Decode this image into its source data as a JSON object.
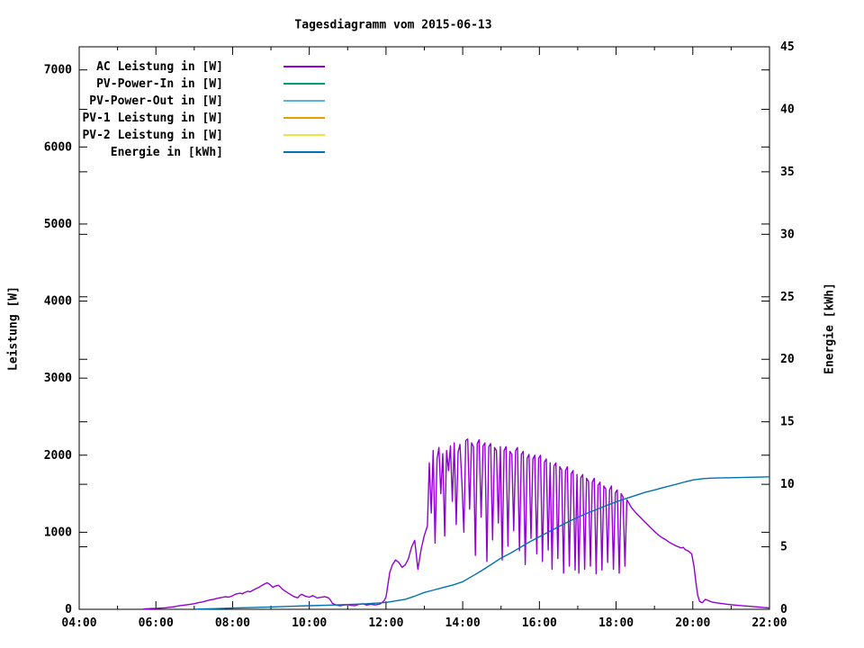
{
  "chart_data": {
    "type": "line",
    "title": "Tagesdiagramm vom 2015-06-13",
    "background": "#ffffff",
    "text_color": "#000000",
    "x_axis": {
      "range_hours": [
        4,
        22
      ],
      "major_ticks": [
        "04:00",
        "06:00",
        "08:00",
        "10:00",
        "12:00",
        "14:00",
        "16:00",
        "18:00",
        "20:00",
        "22:00"
      ],
      "minor_tick_hours": [
        5,
        7,
        9,
        11,
        13,
        15,
        17,
        19,
        21
      ]
    },
    "y_left": {
      "label": "Leistung [W]",
      "range": [
        0,
        7300
      ],
      "ticks": [
        0,
        1000,
        2000,
        3000,
        4000,
        5000,
        6000,
        7000
      ]
    },
    "y_right": {
      "label": "Energie [kWh]",
      "range": [
        0,
        45
      ],
      "ticks": [
        0,
        5,
        10,
        15,
        20,
        25,
        30,
        35,
        40,
        45
      ]
    },
    "legend": [
      {
        "label": "AC Leistung in [W]",
        "color": "#9400d3"
      },
      {
        "label": "PV-Power-In in [W]",
        "color": "#009e73"
      },
      {
        "label": "PV-Power-Out in [W]",
        "color": "#56b4e9"
      },
      {
        "label": "PV-1 Leistung in [W]",
        "color": "#e69f00"
      },
      {
        "label": "PV-2 Leistung in [W]",
        "color": "#f0e442"
      },
      {
        "label": "Energie in [kWh]",
        "color": "#0072b2"
      }
    ],
    "series": [
      {
        "name": "AC Leistung in [W]",
        "color": "#9400d3",
        "axis": "left",
        "visible": true,
        "points": [
          [
            5.67,
            5
          ],
          [
            5.8,
            8
          ],
          [
            5.9,
            10
          ],
          [
            6.0,
            12
          ],
          [
            6.1,
            15
          ],
          [
            6.25,
            20
          ],
          [
            6.4,
            28
          ],
          [
            6.5,
            35
          ],
          [
            6.6,
            45
          ],
          [
            6.75,
            55
          ],
          [
            6.9,
            65
          ],
          [
            7.0,
            72
          ],
          [
            7.1,
            85
          ],
          [
            7.2,
            95
          ],
          [
            7.3,
            108
          ],
          [
            7.4,
            120
          ],
          [
            7.5,
            130
          ],
          [
            7.6,
            142
          ],
          [
            7.7,
            152
          ],
          [
            7.8,
            162
          ],
          [
            7.9,
            158
          ],
          [
            8.0,
            175
          ],
          [
            8.05,
            190
          ],
          [
            8.1,
            200
          ],
          [
            8.2,
            210
          ],
          [
            8.25,
            200
          ],
          [
            8.3,
            215
          ],
          [
            8.4,
            235
          ],
          [
            8.45,
            225
          ],
          [
            8.5,
            240
          ],
          [
            8.6,
            265
          ],
          [
            8.7,
            290
          ],
          [
            8.75,
            305
          ],
          [
            8.8,
            320
          ],
          [
            8.9,
            345
          ],
          [
            8.95,
            330
          ],
          [
            9.0,
            310
          ],
          [
            9.05,
            285
          ],
          [
            9.1,
            300
          ],
          [
            9.2,
            312
          ],
          [
            9.3,
            260
          ],
          [
            9.4,
            225
          ],
          [
            9.5,
            195
          ],
          [
            9.6,
            165
          ],
          [
            9.7,
            150
          ],
          [
            9.75,
            178
          ],
          [
            9.8,
            195
          ],
          [
            9.9,
            168
          ],
          [
            10.0,
            158
          ],
          [
            10.1,
            178
          ],
          [
            10.2,
            148
          ],
          [
            10.3,
            155
          ],
          [
            10.4,
            165
          ],
          [
            10.5,
            150
          ],
          [
            10.55,
            120
          ],
          [
            10.6,
            80
          ],
          [
            10.7,
            55
          ],
          [
            10.8,
            45
          ],
          [
            10.9,
            55
          ],
          [
            11.0,
            60
          ],
          [
            11.1,
            50
          ],
          [
            11.2,
            48
          ],
          [
            11.3,
            65
          ],
          [
            11.4,
            70
          ],
          [
            11.5,
            55
          ],
          [
            11.6,
            65
          ],
          [
            11.7,
            58
          ],
          [
            11.75,
            60
          ],
          [
            11.85,
            70
          ],
          [
            11.95,
            110
          ],
          [
            12.0,
            160
          ],
          [
            12.05,
            320
          ],
          [
            12.1,
            480
          ],
          [
            12.17,
            580
          ],
          [
            12.25,
            640
          ],
          [
            12.33,
            610
          ],
          [
            12.42,
            545
          ],
          [
            12.5,
            575
          ],
          [
            12.58,
            650
          ],
          [
            12.67,
            810
          ],
          [
            12.75,
            895
          ],
          [
            12.83,
            520
          ],
          [
            12.92,
            790
          ],
          [
            13.0,
            960
          ],
          [
            13.08,
            1080
          ],
          [
            13.13,
            1900
          ],
          [
            13.18,
            1250
          ],
          [
            13.23,
            2060
          ],
          [
            13.28,
            860
          ],
          [
            13.33,
            1950
          ],
          [
            13.38,
            2100
          ],
          [
            13.43,
            1500
          ],
          [
            13.48,
            2020
          ],
          [
            13.53,
            950
          ],
          [
            13.58,
            2060
          ],
          [
            13.63,
            1800
          ],
          [
            13.68,
            2120
          ],
          [
            13.73,
            1400
          ],
          [
            13.78,
            2160
          ],
          [
            13.83,
            1100
          ],
          [
            13.88,
            2040
          ],
          [
            13.93,
            2140
          ],
          [
            13.98,
            1620
          ],
          [
            14.03,
            1000
          ],
          [
            14.08,
            2190
          ],
          [
            14.13,
            2210
          ],
          [
            14.18,
            1300
          ],
          [
            14.23,
            2160
          ],
          [
            14.28,
            2110
          ],
          [
            14.33,
            700
          ],
          [
            14.38,
            2150
          ],
          [
            14.43,
            2200
          ],
          [
            14.48,
            1200
          ],
          [
            14.53,
            2120
          ],
          [
            14.58,
            2160
          ],
          [
            14.63,
            620
          ],
          [
            14.68,
            2110
          ],
          [
            14.73,
            2150
          ],
          [
            14.78,
            900
          ],
          [
            14.83,
            2100
          ],
          [
            14.88,
            2060
          ],
          [
            14.93,
            1120
          ],
          [
            14.98,
            2110
          ],
          [
            15.03,
            640
          ],
          [
            15.08,
            2060
          ],
          [
            15.13,
            2110
          ],
          [
            15.18,
            820
          ],
          [
            15.23,
            2050
          ],
          [
            15.28,
            2010
          ],
          [
            15.33,
            1020
          ],
          [
            15.38,
            2060
          ],
          [
            15.43,
            2100
          ],
          [
            15.48,
            760
          ],
          [
            15.53,
            2010
          ],
          [
            15.58,
            2050
          ],
          [
            15.63,
            580
          ],
          [
            15.68,
            1960
          ],
          [
            15.73,
            2010
          ],
          [
            15.78,
            920
          ],
          [
            15.83,
            1950
          ],
          [
            15.88,
            2000
          ],
          [
            15.93,
            720
          ],
          [
            15.98,
            1960
          ],
          [
            16.03,
            2000
          ],
          [
            16.08,
            620
          ],
          [
            16.13,
            1910
          ],
          [
            16.18,
            1950
          ],
          [
            16.23,
            770
          ],
          [
            16.28,
            1900
          ],
          [
            16.33,
            520
          ],
          [
            16.38,
            1860
          ],
          [
            16.43,
            1900
          ],
          [
            16.48,
            660
          ],
          [
            16.53,
            1850
          ],
          [
            16.58,
            1810
          ],
          [
            16.63,
            470
          ],
          [
            16.68,
            1800
          ],
          [
            16.73,
            1850
          ],
          [
            16.78,
            560
          ],
          [
            16.83,
            1760
          ],
          [
            16.88,
            1800
          ],
          [
            16.93,
            510
          ],
          [
            16.98,
            1750
          ],
          [
            17.03,
            470
          ],
          [
            17.08,
            1710
          ],
          [
            17.13,
            1750
          ],
          [
            17.18,
            520
          ],
          [
            17.23,
            1700
          ],
          [
            17.28,
            1660
          ],
          [
            17.33,
            560
          ],
          [
            17.38,
            1650
          ],
          [
            17.43,
            1700
          ],
          [
            17.48,
            460
          ],
          [
            17.53,
            1610
          ],
          [
            17.58,
            1650
          ],
          [
            17.63,
            510
          ],
          [
            17.68,
            1600
          ],
          [
            17.73,
            1560
          ],
          [
            17.78,
            610
          ],
          [
            17.83,
            1550
          ],
          [
            17.88,
            1600
          ],
          [
            17.93,
            520
          ],
          [
            17.98,
            1510
          ],
          [
            18.03,
            1550
          ],
          [
            18.08,
            470
          ],
          [
            18.13,
            1500
          ],
          [
            18.18,
            1460
          ],
          [
            18.23,
            560
          ],
          [
            18.28,
            1420
          ],
          [
            18.33,
            1380
          ],
          [
            18.4,
            1320
          ],
          [
            18.5,
            1260
          ],
          [
            18.6,
            1210
          ],
          [
            18.7,
            1160
          ],
          [
            18.8,
            1110
          ],
          [
            18.9,
            1060
          ],
          [
            19.0,
            1010
          ],
          [
            19.1,
            965
          ],
          [
            19.2,
            930
          ],
          [
            19.3,
            900
          ],
          [
            19.4,
            865
          ],
          [
            19.5,
            840
          ],
          [
            19.6,
            815
          ],
          [
            19.7,
            795
          ],
          [
            19.75,
            805
          ],
          [
            19.8,
            775
          ],
          [
            19.9,
            750
          ],
          [
            19.97,
            720
          ],
          [
            20.03,
            560
          ],
          [
            20.08,
            350
          ],
          [
            20.13,
            180
          ],
          [
            20.18,
            100
          ],
          [
            20.25,
            85
          ],
          [
            20.33,
            130
          ],
          [
            20.42,
            110
          ],
          [
            20.5,
            95
          ],
          [
            20.6,
            85
          ],
          [
            20.75,
            75
          ],
          [
            20.9,
            65
          ],
          [
            21.1,
            55
          ],
          [
            21.3,
            45
          ],
          [
            21.5,
            38
          ],
          [
            21.7,
            30
          ],
          [
            21.85,
            22
          ],
          [
            22.0,
            18
          ]
        ]
      },
      {
        "name": "PV-Power-In in [W]",
        "color": "#009e73",
        "axis": "left",
        "visible": false,
        "points": []
      },
      {
        "name": "PV-Power-Out in [W]",
        "color": "#56b4e9",
        "axis": "left",
        "visible": false,
        "points": []
      },
      {
        "name": "PV-1 Leistung in [W]",
        "color": "#e69f00",
        "axis": "left",
        "visible": false,
        "points": []
      },
      {
        "name": "PV-2 Leistung in [W]",
        "color": "#f0e442",
        "axis": "left",
        "visible": false,
        "points": []
      },
      {
        "name": "Energie in [kWh]",
        "color": "#0072b2",
        "axis": "right",
        "visible": true,
        "points": [
          [
            7.05,
            0.02
          ],
          [
            7.5,
            0.05
          ],
          [
            8.0,
            0.1
          ],
          [
            8.5,
            0.14
          ],
          [
            9.0,
            0.19
          ],
          [
            9.5,
            0.24
          ],
          [
            10.0,
            0.29
          ],
          [
            10.5,
            0.33
          ],
          [
            11.0,
            0.38
          ],
          [
            11.5,
            0.45
          ],
          [
            12.0,
            0.55
          ],
          [
            12.25,
            0.67
          ],
          [
            12.5,
            0.8
          ],
          [
            12.75,
            1.05
          ],
          [
            13.0,
            1.35
          ],
          [
            13.25,
            1.55
          ],
          [
            13.5,
            1.75
          ],
          [
            13.75,
            1.95
          ],
          [
            14.0,
            2.2
          ],
          [
            14.25,
            2.65
          ],
          [
            14.5,
            3.1
          ],
          [
            14.75,
            3.6
          ],
          [
            15.0,
            4.1
          ],
          [
            15.25,
            4.5
          ],
          [
            15.5,
            4.95
          ],
          [
            15.75,
            5.4
          ],
          [
            16.0,
            5.8
          ],
          [
            16.25,
            6.2
          ],
          [
            16.5,
            6.6
          ],
          [
            16.75,
            7.0
          ],
          [
            17.0,
            7.35
          ],
          [
            17.25,
            7.7
          ],
          [
            17.5,
            8.0
          ],
          [
            17.75,
            8.3
          ],
          [
            18.0,
            8.6
          ],
          [
            18.25,
            8.85
          ],
          [
            18.5,
            9.1
          ],
          [
            18.75,
            9.35
          ],
          [
            19.0,
            9.55
          ],
          [
            19.25,
            9.75
          ],
          [
            19.5,
            9.95
          ],
          [
            19.75,
            10.15
          ],
          [
            20.0,
            10.35
          ],
          [
            20.25,
            10.45
          ],
          [
            20.5,
            10.5
          ],
          [
            21.0,
            10.53
          ],
          [
            21.5,
            10.56
          ],
          [
            22.0,
            10.6
          ]
        ]
      }
    ]
  }
}
